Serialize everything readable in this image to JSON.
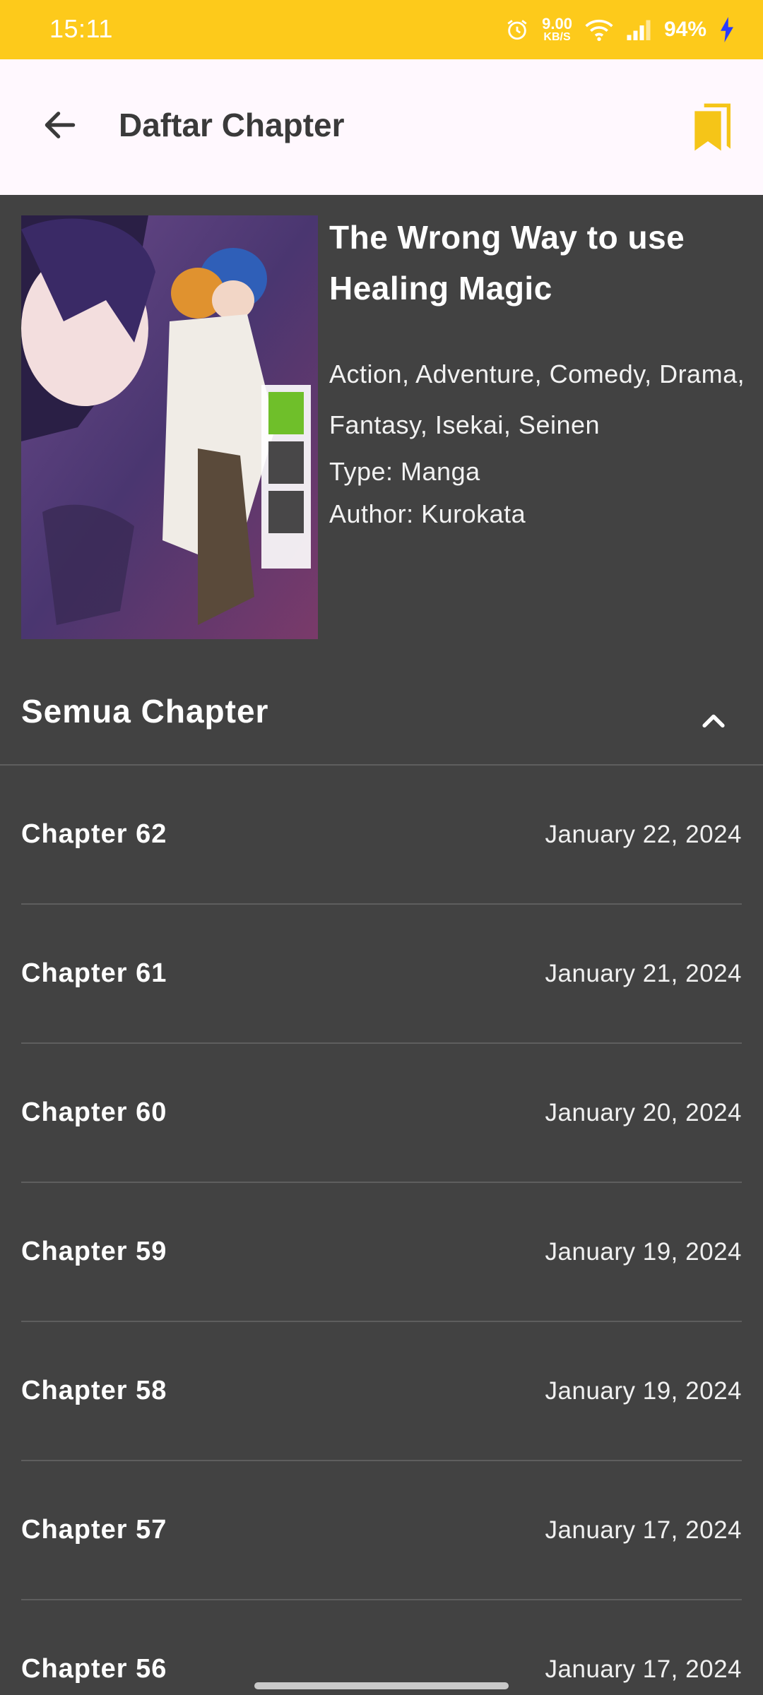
{
  "status_bar": {
    "time": "15:11",
    "net_speed_value": "9.00",
    "net_speed_unit": "KB/S",
    "battery": "94%",
    "icons": [
      "alarm-icon",
      "wifi-icon",
      "signal-icon",
      "charging-icon"
    ]
  },
  "app_bar": {
    "title": "Daftar Chapter",
    "back_icon": "arrow-left-icon",
    "bookmark_icon": "bookmarks-icon"
  },
  "manga": {
    "title": "The Wrong Way to use Healing Magic",
    "genres": "Action, Adventure, Comedy, Drama, Fantasy, Isekai, Seinen",
    "type": "Type: Manga",
    "author": "Author: Kurokata"
  },
  "section": {
    "title": "Semua Chapter",
    "toggle_icon": "chevron-up-icon"
  },
  "chapters": [
    {
      "name": "Chapter 62",
      "date": "January 22, 2024"
    },
    {
      "name": "Chapter 61",
      "date": "January 21, 2024"
    },
    {
      "name": "Chapter 60",
      "date": "January 20, 2024"
    },
    {
      "name": "Chapter 59",
      "date": "January 19, 2024"
    },
    {
      "name": "Chapter 58",
      "date": "January 19, 2024"
    },
    {
      "name": "Chapter 57",
      "date": "January 17, 2024"
    },
    {
      "name": "Chapter 56",
      "date": "January 17, 2024"
    }
  ],
  "colors": {
    "status_bar": "#FDCA1B",
    "app_bar": "#FFF8FE",
    "background": "#424242",
    "accent": "#F5C518"
  }
}
